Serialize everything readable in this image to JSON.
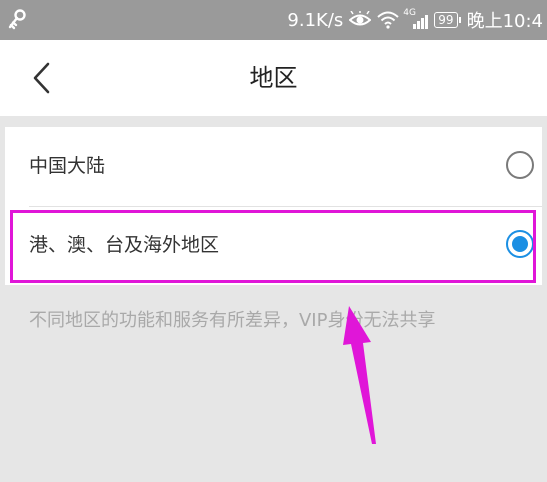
{
  "status_bar": {
    "network_speed": "9.1K/s",
    "signal_label": "4G",
    "battery": "99",
    "time": "晚上10:4"
  },
  "header": {
    "title": "地区"
  },
  "options": [
    {
      "label": "中国大陆",
      "selected": false
    },
    {
      "label": "港、澳、台及海外地区",
      "selected": true
    }
  ],
  "note": "不同地区的功能和服务有所差异，VIP身份无法共享",
  "colors": {
    "accent": "#1b8fe3",
    "highlight": "#e016d8",
    "status_bar": "#9a9a9a"
  },
  "icons": [
    "key-icon",
    "eye-icon",
    "wifi-icon",
    "signal-icon",
    "battery-icon",
    "back-arrow-icon",
    "arrow-annotation"
  ]
}
